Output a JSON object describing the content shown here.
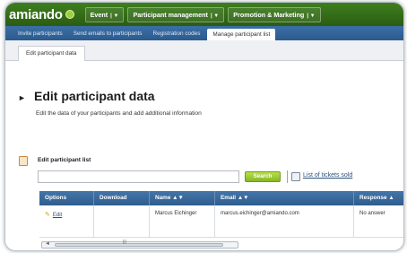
{
  "logo": {
    "text": "amiando"
  },
  "top_menu": [
    {
      "label": "Event"
    },
    {
      "label": "Participant management"
    },
    {
      "label": "Promotion & Marketing"
    }
  ],
  "sub_nav": [
    {
      "label": "Invite participants"
    },
    {
      "label": "Send emails to participants"
    },
    {
      "label": "Registration codes"
    },
    {
      "label": "Manage participant list",
      "active": true
    }
  ],
  "breadcrumb_tab": "Edit participant data",
  "page": {
    "title": "Edit participant data",
    "subtitle": "Edit the data of your participants and add additional information"
  },
  "participant_list": {
    "title": "Edit participant list",
    "search_value": "",
    "search_button": "Search",
    "tickets_link": "List of tickets sold",
    "columns": [
      "Options",
      "Download",
      "Name ▲▼",
      "Email ▲▼",
      "Response ▲"
    ],
    "rows": [
      {
        "option": "Edit",
        "download": "",
        "name": "Marcus Eichinger",
        "email": "marcus.eichinger@amiando.com",
        "response": "No answer"
      }
    ]
  },
  "colors": {
    "top_bar": "#2f6a16",
    "sub_nav": "#2f5d8f",
    "search_button": "#9ccb33"
  }
}
